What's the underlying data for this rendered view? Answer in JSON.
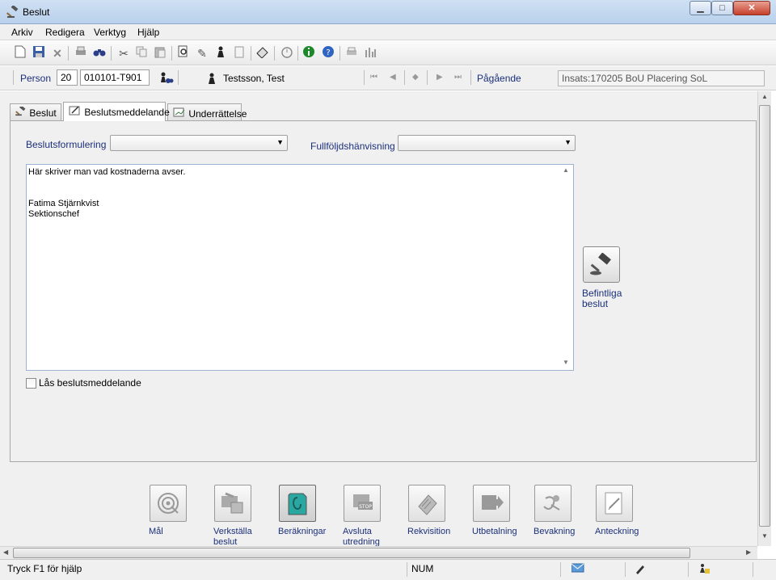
{
  "window": {
    "title": "Beslut",
    "min_glyph": "▁",
    "max_glyph": "□",
    "close_glyph": "✕"
  },
  "menu": {
    "items": [
      "Arkiv",
      "Redigera",
      "Verktyg",
      "Hjälp"
    ]
  },
  "toolbar": {
    "icons": [
      "new-icon",
      "save-icon",
      "delete-icon",
      "print-icon",
      "binoculars-icon",
      "cut-icon",
      "copy-icon",
      "paste-icon",
      "document-search-icon",
      "pin-icon",
      "person-icon",
      "clipboard-icon",
      "eraser-icon",
      "timer-icon",
      "info-icon",
      "help-icon",
      "printer-icon",
      "chart-icon"
    ]
  },
  "personbar": {
    "person_label": "Person",
    "century": "20",
    "person_number": "010101-T901",
    "person_name": "Testsson, Test",
    "status": "Pågående",
    "insats": "Insats:170205 BoU Placering SoL"
  },
  "tabs": [
    {
      "label": "Beslut",
      "icon": "gavel-icon",
      "active": false
    },
    {
      "label": "Beslutsmeddelande",
      "icon": "edit-document-icon",
      "active": true
    },
    {
      "label": "Underrättelse",
      "icon": "notify-document-icon",
      "active": false
    }
  ],
  "form": {
    "formulering_label": "Beslutsformulering",
    "formulering_value": "",
    "fullfoljd_label": "Fullföljdshänvisning",
    "fullfoljd_value": "",
    "text_lines": [
      "Här skriver man vad kostnaderna avser.",
      "",
      "",
      "Fatima Stjärnkvist",
      "Sektionschef"
    ],
    "lock_label": "Lås beslutsmeddelande",
    "lock_checked": false,
    "existing_label_1": "Befintliga",
    "existing_label_2": "beslut"
  },
  "bottom_buttons": [
    {
      "name": "mal",
      "label": "Mål",
      "icon": "target-icon",
      "active": false
    },
    {
      "name": "verkstalla",
      "label": "Verkställa beslut",
      "icon": "execute-icon",
      "active": false
    },
    {
      "name": "berakningar",
      "label": "Beräkningar",
      "icon": "calculation-icon",
      "active": true
    },
    {
      "name": "avsluta",
      "label": "Avsluta utredning",
      "icon": "stop-icon",
      "active": false
    },
    {
      "name": "rekvisition",
      "label": "Rekvisition",
      "icon": "requisition-icon",
      "active": false
    },
    {
      "name": "utbetalning",
      "label": "Utbetalning",
      "icon": "payment-icon",
      "active": false
    },
    {
      "name": "bevakning",
      "label": "Bevakning",
      "icon": "watch-icon",
      "active": false
    },
    {
      "name": "anteckning",
      "label": "Anteckning",
      "icon": "note-icon",
      "active": false
    }
  ],
  "statusbar": {
    "help": "Tryck F1 för hjälp",
    "num": "NUM"
  }
}
